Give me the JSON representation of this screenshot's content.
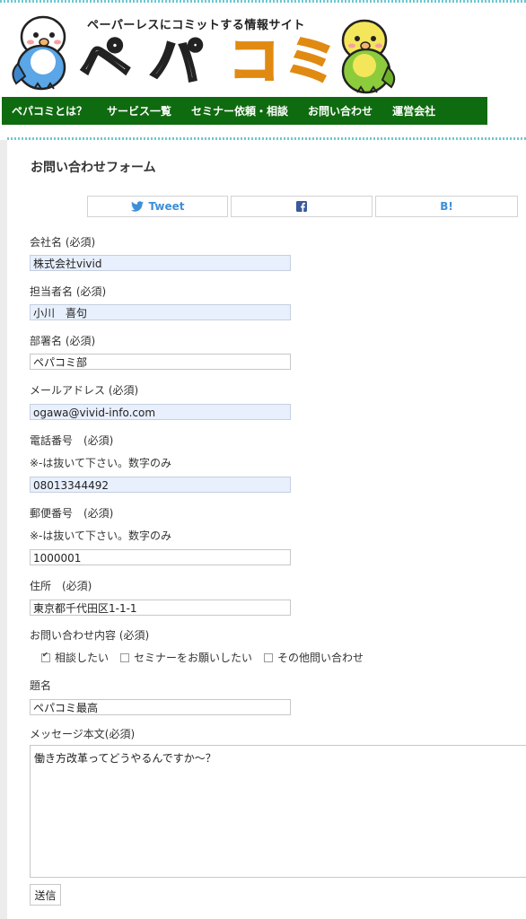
{
  "header": {
    "tagline": "ペーパーレスにコミットする情報サイト",
    "logo": [
      "ペ",
      "パ",
      "コ",
      "ミ"
    ]
  },
  "nav": [
    {
      "label": "ペパコミとは？"
    },
    {
      "label": "サービス一覧"
    },
    {
      "label": "セミナー依頼・相談"
    },
    {
      "label": "お問い合わせ"
    },
    {
      "label": "運営会社"
    }
  ],
  "form": {
    "title": "お問い合わせフォーム",
    "share": {
      "tweet": "Tweet",
      "facebook_icon": "facebook-icon",
      "hatena": "B!"
    },
    "fields": {
      "company": {
        "label": "会社名 (必須)",
        "value": "株式会社vivid"
      },
      "person": {
        "label": "担当者名 (必須)",
        "value": "小川　喜句"
      },
      "department": {
        "label": "部署名 (必須)",
        "value": "ペパコミ部"
      },
      "email": {
        "label": "メールアドレス (必須)",
        "value": "ogawa@vivid-info.com"
      },
      "phone": {
        "label": "電話番号　(必須)",
        "note": "※-は抜いて下さい。数字のみ",
        "value": "08013344492"
      },
      "postal": {
        "label": "郵便番号　(必須)",
        "note": "※-は抜いて下さい。数字のみ",
        "value": "1000001"
      },
      "address": {
        "label": "住所　(必須)",
        "value": "東京都千代田区1-1-1"
      },
      "inquiry": {
        "label": "お問い合わせ内容 (必須)",
        "options": [
          {
            "label": "相談したい",
            "checked": true
          },
          {
            "label": "セミナーをお願いしたい",
            "checked": false
          },
          {
            "label": "その他問い合わせ",
            "checked": false
          }
        ]
      },
      "subject": {
        "label": "題名",
        "value": "ペパコミ最高"
      },
      "message": {
        "label": "メッセージ本文(必須)",
        "value": "働き方改革ってどうやるんですか～？"
      }
    },
    "submit": "送信"
  },
  "colors": {
    "nav_bg": "#0f6b0f",
    "autofill_bg": "#e8f0fe",
    "accent_dots": "#6ec8d0"
  }
}
